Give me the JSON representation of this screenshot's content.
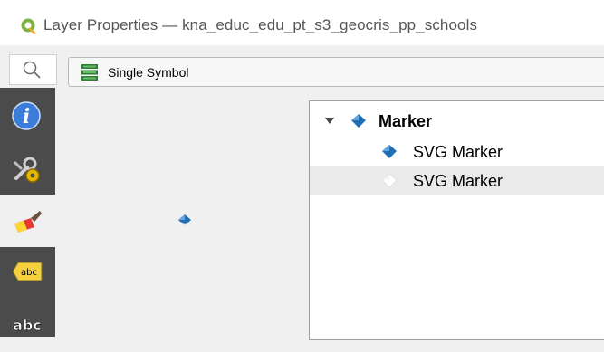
{
  "window": {
    "title": "Layer Properties — kna_educ_edu_pt_s3_geocris_pp_schools",
    "app_icon": "qgis-logo-icon"
  },
  "search": {
    "icon": "search-icon"
  },
  "renderer": {
    "selected": "Single Symbol",
    "icon": "single-symbol-icon"
  },
  "sidebar": {
    "items": [
      {
        "icon": "information-icon",
        "active": false
      },
      {
        "icon": "source-tools-icon",
        "active": false
      },
      {
        "icon": "symbology-brush-icon",
        "active": true
      },
      {
        "icon": "labels-abc-icon",
        "active": false
      },
      {
        "icon": "masks-abc-icon",
        "active": false
      }
    ]
  },
  "symbol_tree": {
    "items": [
      {
        "label": "Marker",
        "level": 0,
        "expanded": true,
        "selected": false
      },
      {
        "label": "SVG Marker",
        "level": 1,
        "selected": false
      },
      {
        "label": "SVG Marker",
        "level": 1,
        "selected": true
      }
    ]
  },
  "colors": {
    "marker_blue": "#1f6fb2",
    "sidebar_bg": "#4b4b4b",
    "selection_bg": "#eaeaea"
  }
}
